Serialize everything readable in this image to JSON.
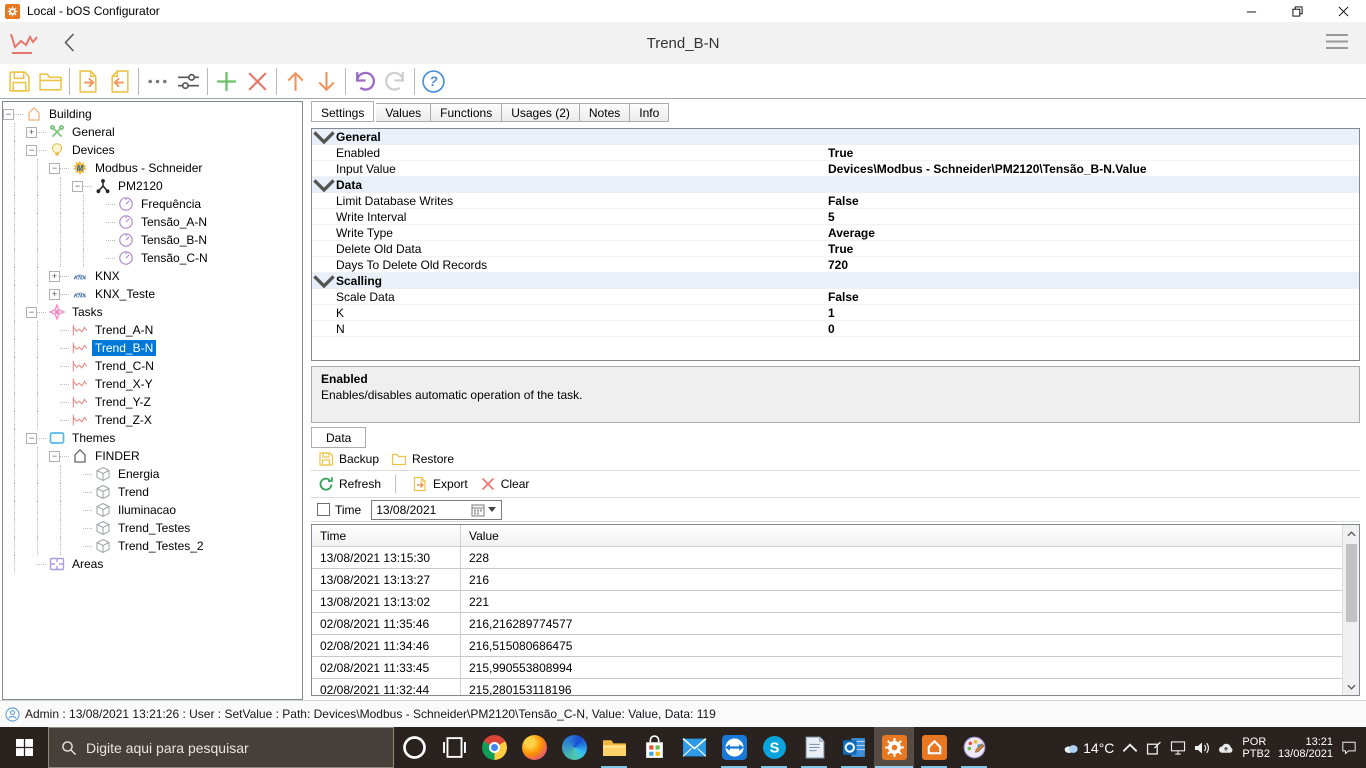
{
  "window": {
    "title": "Local - bOS Configurator"
  },
  "header": {
    "title": "Trend_B-N"
  },
  "toolbar": {
    "buttons": [
      {
        "name": "save"
      },
      {
        "name": "open"
      },
      {
        "sep": true
      },
      {
        "name": "export"
      },
      {
        "name": "import"
      },
      {
        "sep": true
      },
      {
        "name": "more"
      },
      {
        "name": "filter"
      },
      {
        "sep": true
      },
      {
        "name": "add"
      },
      {
        "name": "delete"
      },
      {
        "sep": true
      },
      {
        "name": "move-up"
      },
      {
        "name": "move-down"
      },
      {
        "sep": true
      },
      {
        "name": "undo"
      },
      {
        "name": "redo"
      },
      {
        "sep": true
      },
      {
        "name": "help"
      }
    ]
  },
  "tree": {
    "items": [
      {
        "label": "Building",
        "depth": 0,
        "icon": "house-orange",
        "box": "-"
      },
      {
        "label": "General",
        "depth": 1,
        "icon": "tools",
        "box": "+"
      },
      {
        "label": "Devices",
        "depth": 1,
        "icon": "bulb",
        "box": "-"
      },
      {
        "label": "Modbus - Schneider",
        "depth": 2,
        "icon": "modbus",
        "box": "-"
      },
      {
        "label": "PM2120",
        "depth": 3,
        "icon": "network",
        "box": "-"
      },
      {
        "label": "Frequência",
        "depth": 4,
        "icon": "gauge"
      },
      {
        "label": "Tensão_A-N",
        "depth": 4,
        "icon": "gauge"
      },
      {
        "label": "Tensão_B-N",
        "depth": 4,
        "icon": "gauge"
      },
      {
        "label": "Tensão_C-N",
        "depth": 4,
        "icon": "gauge"
      },
      {
        "label": "KNX",
        "depth": 2,
        "icon": "knx",
        "box": "+"
      },
      {
        "label": "KNX_Teste",
        "depth": 2,
        "icon": "knx",
        "box": "+"
      },
      {
        "label": "Tasks",
        "depth": 1,
        "icon": "tasks",
        "box": "-"
      },
      {
        "label": "Trend_A-N",
        "depth": 2,
        "icon": "trend"
      },
      {
        "label": "Trend_B-N",
        "depth": 2,
        "icon": "trend",
        "selected": true
      },
      {
        "label": "Trend_C-N",
        "depth": 2,
        "icon": "trend"
      },
      {
        "label": "Trend_X-Y",
        "depth": 2,
        "icon": "trend"
      },
      {
        "label": "Trend_Y-Z",
        "depth": 2,
        "icon": "trend"
      },
      {
        "label": "Trend_Z-X",
        "depth": 2,
        "icon": "trend"
      },
      {
        "label": "Themes",
        "depth": 1,
        "icon": "themes",
        "box": "-"
      },
      {
        "label": "FINDER",
        "depth": 2,
        "icon": "house-gray",
        "box": "-"
      },
      {
        "label": "Energia",
        "depth": 3,
        "icon": "cube"
      },
      {
        "label": "Trend",
        "depth": 3,
        "icon": "cube"
      },
      {
        "label": "Iluminacao",
        "depth": 3,
        "icon": "cube"
      },
      {
        "label": "Trend_Testes",
        "depth": 3,
        "icon": "cube"
      },
      {
        "label": "Trend_Testes_2",
        "depth": 3,
        "icon": "cube"
      },
      {
        "label": "Areas",
        "depth": 1,
        "icon": "areas"
      }
    ]
  },
  "tabs": {
    "items": [
      "Settings",
      "Values",
      "Functions",
      "Usages (2)",
      "Notes",
      "Info"
    ],
    "active": 0
  },
  "settings": {
    "groups": [
      {
        "name": "General",
        "rows": [
          {
            "label": "Enabled",
            "value": "True"
          },
          {
            "label": "Input Value",
            "value": "Devices\\Modbus - Schneider\\PM2120\\Tensão_B-N.Value"
          }
        ]
      },
      {
        "name": "Data",
        "rows": [
          {
            "label": "Limit Database Writes",
            "value": "False"
          },
          {
            "label": "Write Interval",
            "value": "5"
          },
          {
            "label": "Write Type",
            "value": "Average"
          },
          {
            "label": "Delete Old Data",
            "value": "True"
          },
          {
            "label": "Days To Delete Old Records",
            "value": "720"
          }
        ]
      },
      {
        "name": "Scalling",
        "rows": [
          {
            "label": "Scale Data",
            "value": "False"
          },
          {
            "label": "K",
            "value": "1"
          },
          {
            "label": "N",
            "value": "0"
          }
        ]
      }
    ]
  },
  "description": {
    "title": "Enabled",
    "text": "Enables/disables automatic operation of the task."
  },
  "data_panel": {
    "tab": "Data",
    "backup_label": "Backup",
    "restore_label": "Restore",
    "refresh_label": "Refresh",
    "export_label": "Export",
    "clear_label": "Clear",
    "time_label": "Time",
    "time_checked": false,
    "date_value": "13/08/2021"
  },
  "table": {
    "columns": [
      "Time",
      "Value"
    ],
    "rows": [
      [
        "13/08/2021 13:15:30",
        "228"
      ],
      [
        "13/08/2021 13:13:27",
        "216"
      ],
      [
        "13/08/2021 13:13:02",
        "221"
      ],
      [
        "02/08/2021 11:35:46",
        "216,216289774577"
      ],
      [
        "02/08/2021 11:34:46",
        "216,515080686475"
      ],
      [
        "02/08/2021 11:33:45",
        "215,990553808994"
      ],
      [
        "02/08/2021 11:32:44",
        "215,280153118196"
      ]
    ]
  },
  "status_bar": {
    "text": "Admin : 13/08/2021 13:21:26 : User : SetValue : Path: Devices\\Modbus - Schneider\\PM2120\\Tensão_C-N, Value: Value, Data: 119"
  },
  "taskbar": {
    "search_placeholder": "Digite aqui para pesquisar",
    "apps": [
      {
        "name": "cortana"
      },
      {
        "name": "task-view"
      },
      {
        "name": "chrome"
      },
      {
        "name": "firefox"
      },
      {
        "name": "edge"
      },
      {
        "name": "file-explorer",
        "running": true
      },
      {
        "name": "store"
      },
      {
        "name": "mail"
      },
      {
        "name": "teamviewer",
        "running": true
      },
      {
        "name": "skype",
        "running": true
      },
      {
        "name": "notepad",
        "running": true
      },
      {
        "name": "outlook",
        "running": true
      },
      {
        "name": "bos-configurator",
        "running": true,
        "active": true
      },
      {
        "name": "bos-builder",
        "running": true
      },
      {
        "name": "paint",
        "running": true
      }
    ],
    "tray": {
      "temp": "14°C",
      "lang_line1": "POR",
      "lang_line2": "PTB2",
      "time": "13:21",
      "date": "13/08/2021"
    }
  },
  "colors": {
    "accent_orange": "#e87722",
    "selection_blue": "#0078d7",
    "group_row": "#eaf0f9",
    "trend_red": "#e8756b",
    "run_indicator": "#7fc5e8"
  }
}
